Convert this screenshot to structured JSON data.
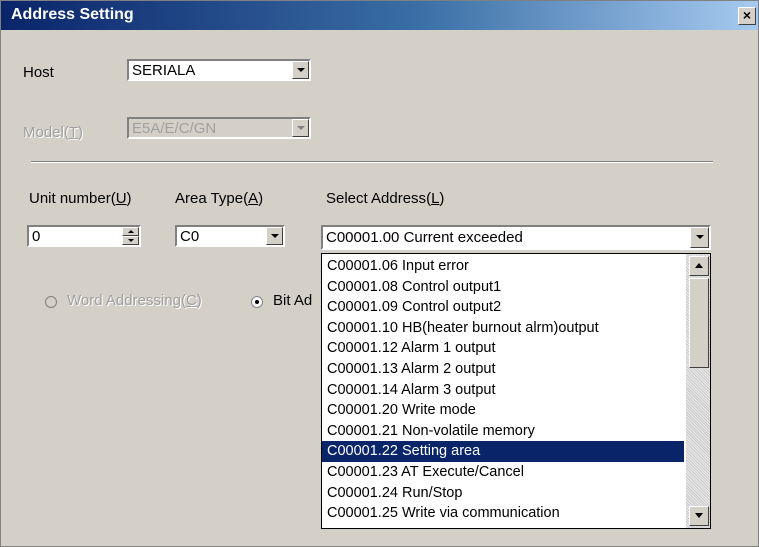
{
  "window": {
    "title": "Address Setting",
    "close_glyph": "×"
  },
  "host": {
    "label": "Host",
    "value": "SERIALA"
  },
  "model": {
    "label": "Model",
    "accesskey": "T",
    "value": "E5A/E/C/GN"
  },
  "unit_number": {
    "label": "Unit number",
    "accesskey": "U",
    "value": "0"
  },
  "area_type": {
    "label": "Area Type",
    "accesskey": "A",
    "value": "C0"
  },
  "select_address": {
    "label": "Select Address",
    "accesskey": "L",
    "value": "C00001.00 Current exceeded",
    "options": [
      "C00001.06 Input error",
      "C00001.08 Control output1",
      "C00001.09 Control output2",
      "C00001.10 HB(heater burnout alrm)output",
      "C00001.12 Alarm 1 output",
      "C00001.13 Alarm 2 output",
      "C00001.14 Alarm 3 output",
      "C00001.20 Write mode",
      "C00001.21 Non-volatile memory",
      "C00001.22 Setting area",
      "C00001.23 AT Execute/Cancel",
      "C00001.24 Run/Stop",
      "C00001.25 Write via communication"
    ],
    "selected": "C00001.22 Setting area"
  },
  "addressing": {
    "word": {
      "label": "Word Addressing",
      "accesskey": "C"
    },
    "bit": {
      "label": "Bit Ad"
    }
  },
  "colors": {
    "selection": "#0a246a",
    "face": "#d4d0c8"
  }
}
